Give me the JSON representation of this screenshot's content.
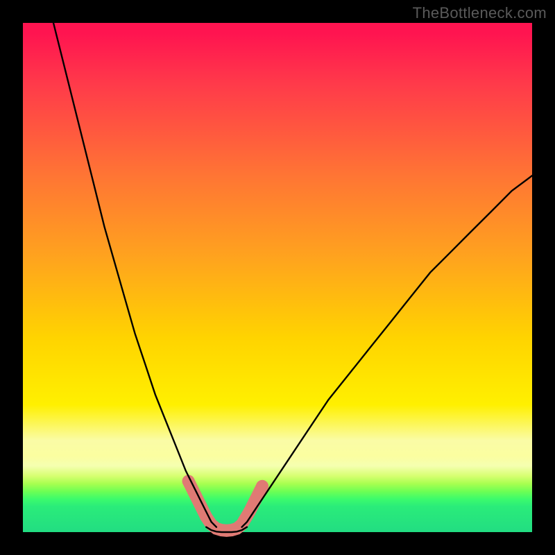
{
  "watermark": "TheBottleneck.com",
  "colors": {
    "frame": "#000000",
    "gradient_top": "#ff1450",
    "gradient_mid": "#ffd400",
    "gradient_bottom": "#22dd82",
    "curve": "#000000",
    "markers": "#e07a74"
  },
  "chart_data": {
    "type": "line",
    "title": "",
    "xlabel": "",
    "ylabel": "",
    "xlim": [
      0,
      100
    ],
    "ylim": [
      0,
      100
    ],
    "series": [
      {
        "name": "left-branch",
        "x": [
          6,
          8,
          10,
          12,
          14,
          16,
          18,
          20,
          22,
          24,
          26,
          28,
          30,
          32,
          34,
          35,
          36,
          37,
          38
        ],
        "values": [
          100,
          92,
          84,
          76,
          68,
          60,
          53,
          46,
          39,
          33,
          27,
          22,
          17,
          12,
          8,
          6,
          4,
          2,
          1
        ]
      },
      {
        "name": "right-branch",
        "x": [
          43,
          44,
          46,
          48,
          52,
          56,
          60,
          64,
          68,
          72,
          76,
          80,
          84,
          88,
          92,
          96,
          100
        ],
        "values": [
          1,
          2,
          5,
          8,
          14,
          20,
          26,
          31,
          36,
          41,
          46,
          51,
          55,
          59,
          63,
          67,
          70
        ]
      },
      {
        "name": "valley-floor",
        "x": [
          36,
          37,
          38,
          39,
          40,
          41,
          42,
          43,
          44
        ],
        "values": [
          1,
          0.4,
          0.1,
          0,
          0,
          0,
          0.1,
          0.4,
          1
        ]
      }
    ],
    "markers": {
      "name": "highlighted-points",
      "color": "#e07a74",
      "points": [
        {
          "x": 32.5,
          "y": 10
        },
        {
          "x": 33.5,
          "y": 8
        },
        {
          "x": 35,
          "y": 5
        },
        {
          "x": 36,
          "y": 3
        },
        {
          "x": 37,
          "y": 1.5
        },
        {
          "x": 38,
          "y": 0.7
        },
        {
          "x": 39,
          "y": 0.4
        },
        {
          "x": 40,
          "y": 0.3
        },
        {
          "x": 41,
          "y": 0.4
        },
        {
          "x": 42,
          "y": 0.7
        },
        {
          "x": 43,
          "y": 1.5
        },
        {
          "x": 44.5,
          "y": 4
        },
        {
          "x": 45.5,
          "y": 6
        },
        {
          "x": 47,
          "y": 9
        }
      ]
    }
  }
}
